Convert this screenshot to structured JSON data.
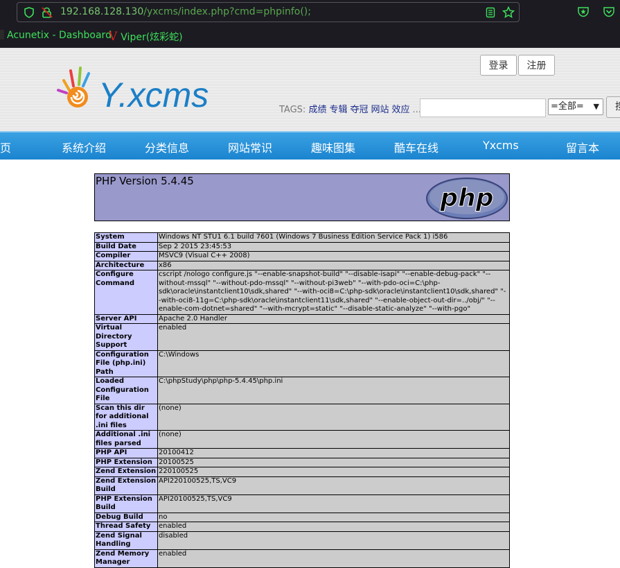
{
  "browser": {
    "url_host": "192.168.128.130",
    "url_path": "/yxcms/index.php?cmd=phpinfo();",
    "bookmarks": [
      {
        "label": "Acunetix - Dashboard"
      },
      {
        "label": "Viper(炫彩蛇)",
        "icon_letter": "V"
      }
    ]
  },
  "site": {
    "logo_text": "Y.xcms",
    "login_label": "登录",
    "register_label": "注册",
    "tags_label": "TAGS:",
    "tags": [
      "成绩",
      "专辑",
      "夺冠",
      "网站",
      "效应"
    ],
    "tags_more": "...",
    "search_placeholder": "",
    "search_scope": "=全部=",
    "search_button": "搜",
    "nav": [
      "页",
      "系统介绍",
      "分类信息",
      "网站常识",
      "趣味图集",
      "酷车在线",
      "Yxcms",
      "留言本"
    ]
  },
  "phpinfo": {
    "version_title": "PHP Version 5.4.45",
    "rows": [
      {
        "k": "System",
        "v": "Windows NT STU1 6.1 build 7601 (Windows 7 Business Edition Service Pack 1) i586"
      },
      {
        "k": "Build Date",
        "v": "Sep 2 2015 23:45:53"
      },
      {
        "k": "Compiler",
        "v": "MSVC9 (Visual C++ 2008)"
      },
      {
        "k": "Architecture",
        "v": "x86"
      },
      {
        "k": "Configure Command",
        "v": "cscript /nologo configure.js \"--enable-snapshot-build\" \"--disable-isapi\" \"--enable-debug-pack\" \"--without-mssql\" \"--without-pdo-mssql\" \"--without-pi3web\" \"--with-pdo-oci=C:\\php-sdk\\oracle\\instantclient10\\sdk,shared\" \"--with-oci8=C:\\php-sdk\\oracle\\instantclient10\\sdk,shared\" \"--with-oci8-11g=C:\\php-sdk\\oracle\\instantclient11\\sdk,shared\" \"--enable-object-out-dir=../obj/\" \"--enable-com-dotnet=shared\" \"--with-mcrypt=static\" \"--disable-static-analyze\" \"--with-pgo\""
      },
      {
        "k": "Server API",
        "v": "Apache 2.0 Handler"
      },
      {
        "k": "Virtual Directory Support",
        "v": "enabled"
      },
      {
        "k": "Configuration File (php.ini) Path",
        "v": "C:\\Windows"
      },
      {
        "k": "Loaded Configuration File",
        "v": "C:\\phpStudy\\php\\php-5.4.45\\php.ini"
      },
      {
        "k": "Scan this dir for additional .ini files",
        "v": "(none)"
      },
      {
        "k": "Additional .ini files parsed",
        "v": "(none)"
      },
      {
        "k": "PHP API",
        "v": "20100412"
      },
      {
        "k": "PHP Extension",
        "v": "20100525"
      },
      {
        "k": "Zend Extension",
        "v": "220100525"
      },
      {
        "k": "Zend Extension Build",
        "v": "API220100525,TS,VC9"
      },
      {
        "k": "PHP Extension Build",
        "v": "API20100525,TS,VC9"
      },
      {
        "k": "Debug Build",
        "v": "no"
      },
      {
        "k": "Thread Safety",
        "v": "enabled"
      },
      {
        "k": "Zend Signal Handling",
        "v": "disabled"
      },
      {
        "k": "Zend Memory Manager",
        "v": "enabled"
      }
    ]
  },
  "colors": {
    "url_green": "#79c76e",
    "bookmark_green": "#3ee05a",
    "nav_blue": "#1f8bd4",
    "php_header": "#9999cc",
    "php_key_bg": "#ccccff",
    "php_val_bg": "#cccccc"
  }
}
